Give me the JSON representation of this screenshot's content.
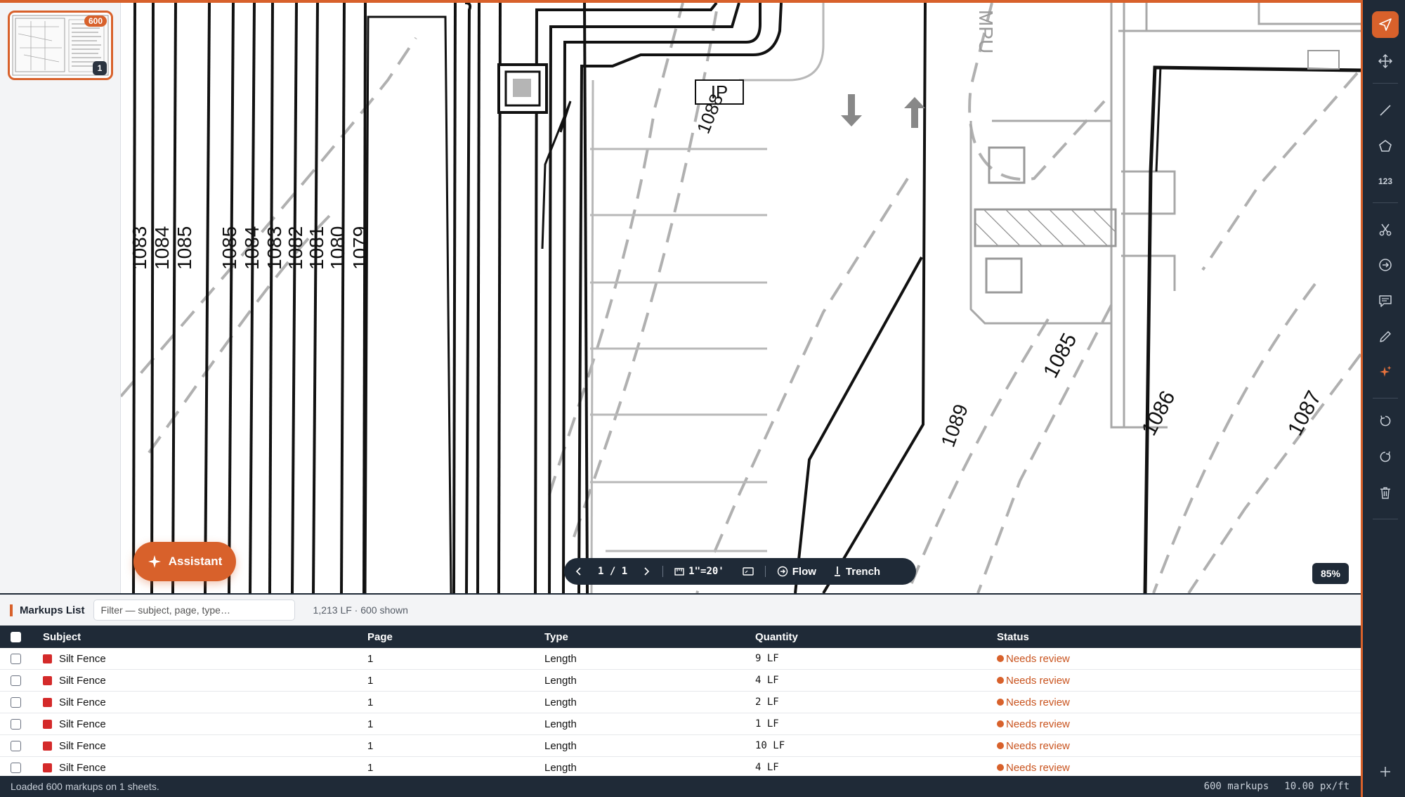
{
  "thumbnail": {
    "markup_count": "600",
    "page_number": "1"
  },
  "drawing": {
    "contour_labels_left": [
      "1083",
      "1084",
      "1085",
      "1085",
      "1084",
      "1083",
      "1082",
      "1081",
      "1080",
      "1079"
    ],
    "label_ip": "IP",
    "label_1088": "1088",
    "label_1089": "1089",
    "label_1085": "1085",
    "label_1086": "1086",
    "label_1087": "1087",
    "label_mpu": "MPU"
  },
  "assistant": {
    "label": "Assistant"
  },
  "floating_toolbar": {
    "page_indicator": "1 / 1",
    "scale": "1\"=20'",
    "flow_label": "Flow",
    "trench_label": "Trench"
  },
  "zoom": "85%",
  "tools": {
    "count_label": "123"
  },
  "markups_panel": {
    "title": "Markups List",
    "filter_placeholder": "Filter — subject, page, type…",
    "summary": "1,213 LF · 600 shown",
    "columns": {
      "subject": "Subject",
      "page": "Page",
      "type": "Type",
      "quantity": "Quantity",
      "status": "Status"
    },
    "rows": [
      {
        "subject": "Silt Fence",
        "page": "1",
        "type": "Length",
        "quantity": "9 LF",
        "status": "Needs review"
      },
      {
        "subject": "Silt Fence",
        "page": "1",
        "type": "Length",
        "quantity": "4 LF",
        "status": "Needs review"
      },
      {
        "subject": "Silt Fence",
        "page": "1",
        "type": "Length",
        "quantity": "2 LF",
        "status": "Needs review"
      },
      {
        "subject": "Silt Fence",
        "page": "1",
        "type": "Length",
        "quantity": "1 LF",
        "status": "Needs review"
      },
      {
        "subject": "Silt Fence",
        "page": "1",
        "type": "Length",
        "quantity": "10 LF",
        "status": "Needs review"
      },
      {
        "subject": "Silt Fence",
        "page": "1",
        "type": "Length",
        "quantity": "4 LF",
        "status": "Needs review"
      }
    ]
  },
  "status_bar": {
    "message": "Loaded 600 markups on 1 sheets.",
    "markup_count": "600 markups",
    "scale_ratio": "10.00 px/ft"
  },
  "colors": {
    "accent": "#d8612b",
    "dark": "#1f2a37",
    "silt_fence": "#d42a2a"
  }
}
